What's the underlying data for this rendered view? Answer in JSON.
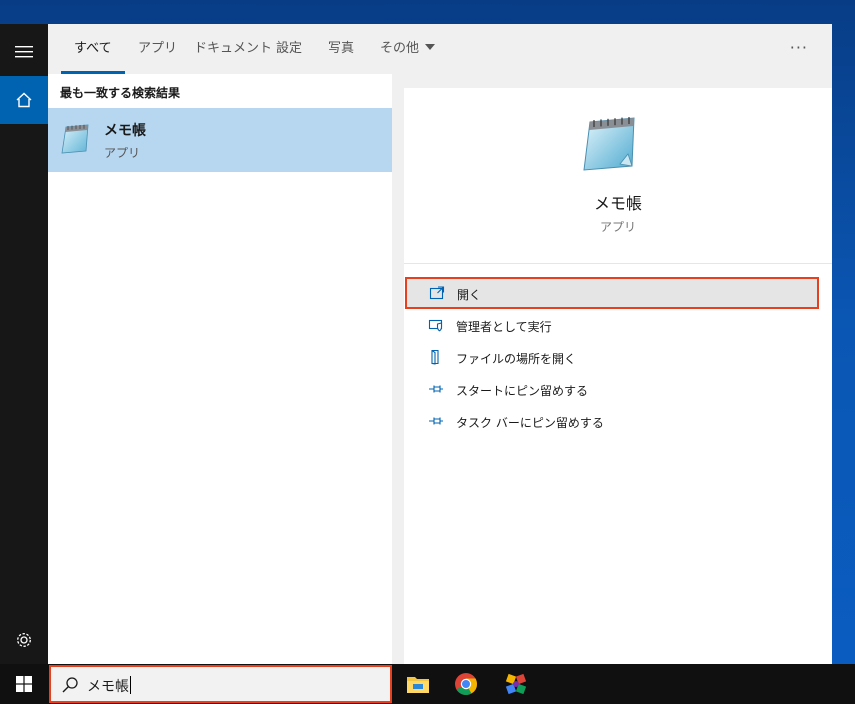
{
  "tabs": [
    {
      "label": "すべて"
    },
    {
      "label": "アプリ"
    },
    {
      "label": "ドキュメント"
    },
    {
      "label": "設定"
    },
    {
      "label": "写真"
    },
    {
      "label": "その他"
    }
  ],
  "more_label": "···",
  "results": {
    "section_label": "最も一致する検索結果",
    "best_match": {
      "name": "メモ帳",
      "type": "アプリ"
    }
  },
  "detail": {
    "name": "メモ帳",
    "type": "アプリ",
    "actions": [
      {
        "label": "開く",
        "icon": "open-icon"
      },
      {
        "label": "管理者として実行",
        "icon": "shield-icon"
      },
      {
        "label": "ファイルの場所を開く",
        "icon": "file-location-icon"
      },
      {
        "label": "スタートにピン留めする",
        "icon": "pin-icon"
      },
      {
        "label": "タスク バーにピン留めする",
        "icon": "pin-icon"
      }
    ]
  },
  "search": {
    "value": "メモ帳"
  },
  "taskbar_apps": [
    "file-explorer-icon",
    "chrome-icon",
    "settings-app-icon"
  ],
  "colors": {
    "accent": "#0063b1",
    "highlight": "#e8401c",
    "selection": "#b7d7f1"
  }
}
